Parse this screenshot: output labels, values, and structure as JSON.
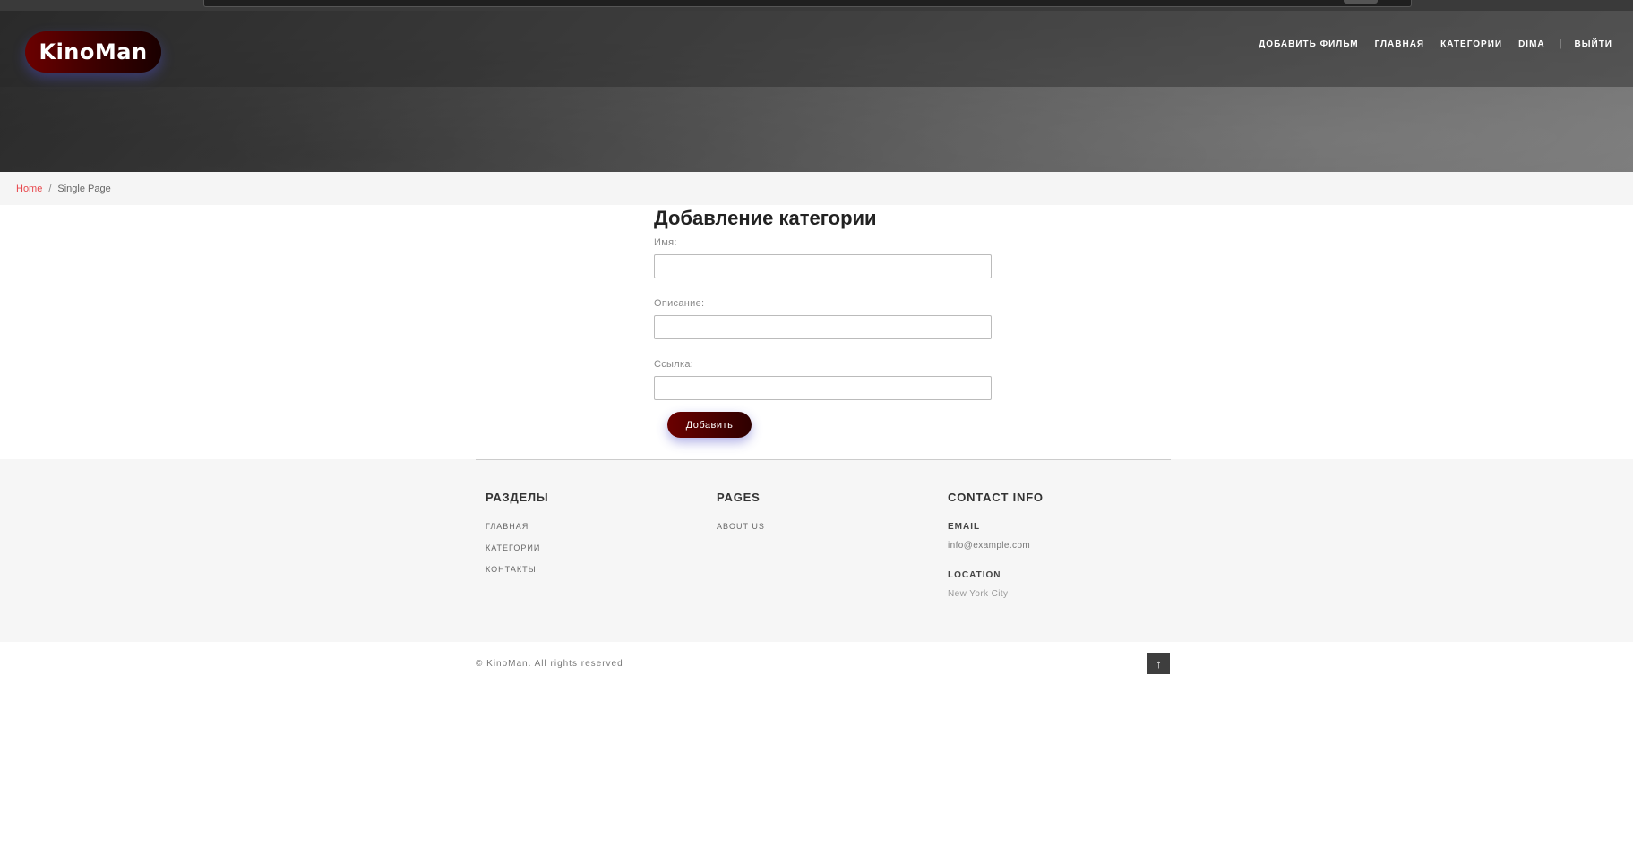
{
  "header": {
    "logo": "KinoMan",
    "nav": {
      "add_movie": "ДОБАВИТЬ ФИЛЬМ",
      "home": "ГЛАВНАЯ",
      "categories": "КАТЕГОРИИ",
      "user": "DIMA",
      "separator": "|",
      "logout": "ВЫЙТИ"
    }
  },
  "breadcrumb": {
    "home": "Home",
    "divider": "/",
    "current": "Single Page"
  },
  "form": {
    "title": "Добавление категории",
    "name_label": "Имя:",
    "name_value": "",
    "description_label": "Описание:",
    "description_value": "",
    "link_label": "Ссылка:",
    "link_value": "",
    "submit_label": "Добавить"
  },
  "footer": {
    "sections": {
      "title": "РАЗДЕЛЫ",
      "items": [
        "ГЛАВНАЯ",
        "КАТЕГОРИИ",
        "КОНТАКТЫ"
      ]
    },
    "pages": {
      "title": "PAGES",
      "items": [
        "ABOUT US"
      ]
    },
    "contact": {
      "title": "CONTACT INFO",
      "email_label": "EMAIL",
      "email_value": "info@example.com",
      "location_label": "LOCATION",
      "location_value": "New York City"
    },
    "copyright": "© KinoMan. All rights reserved",
    "to_top_icon": "arrow-up-icon",
    "to_top_glyph": "↑"
  },
  "colors": {
    "accent_red": "#e8474c",
    "logo_dark_red": "#6b0000",
    "footer_bg": "#f6f6f6"
  }
}
